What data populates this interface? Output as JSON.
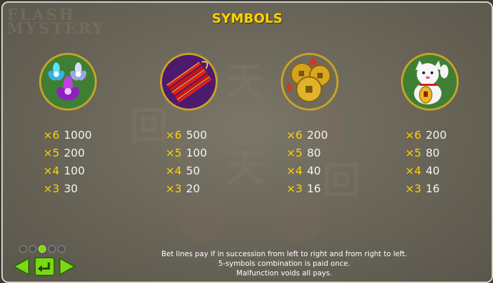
{
  "title": "SYMBOLS",
  "background_logo": [
    "FLASH",
    "MYSTERY"
  ],
  "colors": {
    "accent_yellow": "#ffd200",
    "nav_green": "#7bd816",
    "panel": "#6b675a"
  },
  "symbols": [
    {
      "name": "lotus-flowers-icon",
      "pays": [
        {
          "mult": "×6",
          "value": "1000"
        },
        {
          "mult": "×5",
          "value": "200"
        },
        {
          "mult": "×4",
          "value": "100"
        },
        {
          "mult": "×3",
          "value": "30"
        }
      ]
    },
    {
      "name": "firecrackers-icon",
      "pays": [
        {
          "mult": "×6",
          "value": "500"
        },
        {
          "mult": "×5",
          "value": "100"
        },
        {
          "mult": "×4",
          "value": "50"
        },
        {
          "mult": "×3",
          "value": "20"
        }
      ]
    },
    {
      "name": "coins-icon",
      "pays": [
        {
          "mult": "×6",
          "value": "200"
        },
        {
          "mult": "×5",
          "value": "80"
        },
        {
          "mult": "×4",
          "value": "40"
        },
        {
          "mult": "×3",
          "value": "16"
        }
      ]
    },
    {
      "name": "lucky-cat-icon",
      "pays": [
        {
          "mult": "×6",
          "value": "200"
        },
        {
          "mult": "×5",
          "value": "80"
        },
        {
          "mult": "×4",
          "value": "40"
        },
        {
          "mult": "×3",
          "value": "16"
        }
      ]
    }
  ],
  "pagination": {
    "total": 5,
    "current": 3
  },
  "footer": {
    "line1": "Bet lines pay if in succession from left to right and from right to left.",
    "line2": "5-symbols combination is paid once.",
    "line3": "Malfunction voids all pays."
  }
}
